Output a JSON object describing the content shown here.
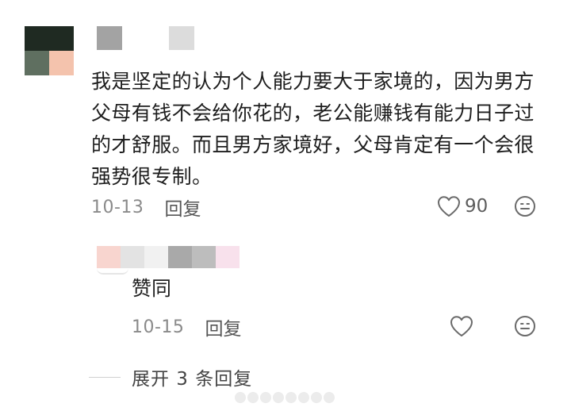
{
  "comment": {
    "text": "我是坚定的认为个人能力要大于家境的，因为男方父母有钱不会给你花的，老公能赚钱有能力日子过的才舒服。而且男方家境好，父母肯定有一个会很强势很专制。",
    "date": "10-13",
    "reply_label": "回复",
    "like_count": "90",
    "like_icon": "heart-outline-icon",
    "emoji_icon": "smiley-face-icon",
    "avatar_colors": [
      "#1f2a22",
      "#3c4d3e",
      "#7c8a7c",
      "#f4c3ad"
    ],
    "name_block_colors": [
      "#a3a3a3",
      "#dcdcdc"
    ]
  },
  "reply": {
    "text": "赞同",
    "date": "10-15",
    "reply_label": "回复",
    "like_icon": "heart-outline-icon",
    "emoji_icon": "smiley-face-icon",
    "name_block_colors": [
      "#f8d5cf",
      "#e3e3e3",
      "#f1f1f1",
      "#a9a9a9",
      "#bdbdbd",
      "#f8e1ec"
    ]
  },
  "expand": {
    "label": "展开 3 条回复"
  }
}
